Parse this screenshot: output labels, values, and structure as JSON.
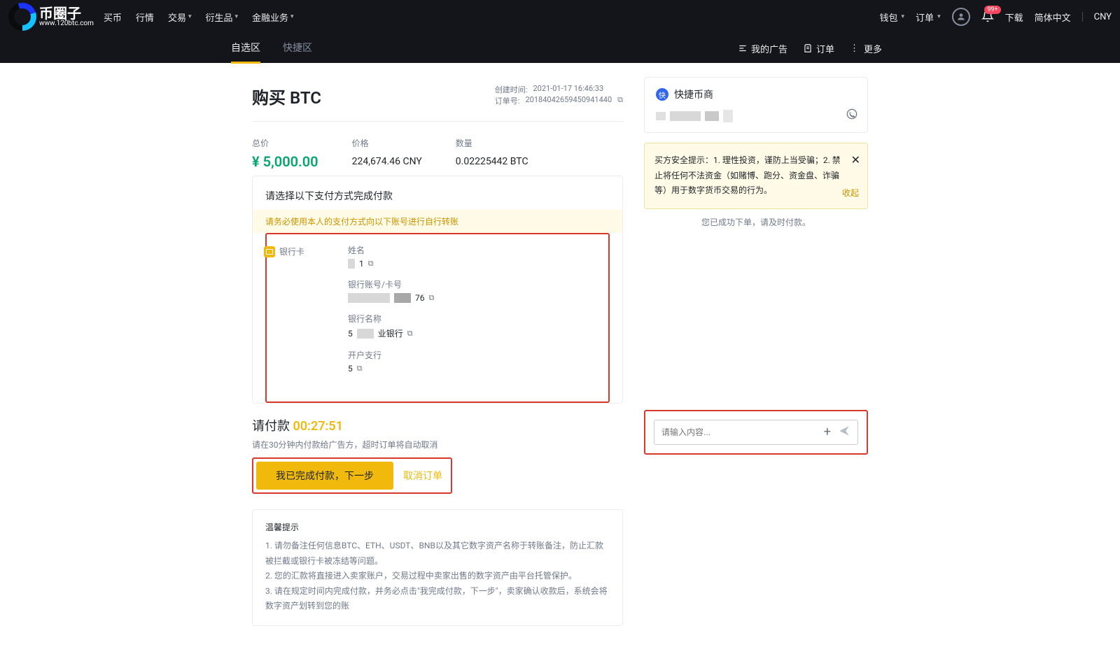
{
  "logo": {
    "cn": "币圈子",
    "url": "www.120btc.com"
  },
  "nav": {
    "buy": "买币",
    "market": "行情",
    "trade": "交易",
    "deriv": "衍生品",
    "finance": "金融业务"
  },
  "topright": {
    "wallet": "钱包",
    "orders": "订单",
    "badge": "99+",
    "download": "下载",
    "lang": "简体中文",
    "currency": "CNY"
  },
  "subnav": {
    "self": "自选区",
    "quick": "快捷区",
    "myads": "我的广告",
    "orders": "订单",
    "more": "更多"
  },
  "header": {
    "title": "购买 BTC",
    "created_label": "创建时间:",
    "created_value": "2021-01-17 16:46:33",
    "order_label": "订单号:",
    "order_value": "20184042659450941440"
  },
  "summary": {
    "total_label": "总价",
    "total_value": "¥ 5,000.00",
    "price_label": "价格",
    "price_value": "224,674.46 CNY",
    "qty_label": "数量",
    "qty_value": "0.02225442 BTC"
  },
  "payment": {
    "title": "请选择以下支付方式完成付款",
    "banner": "请务必使用本人的支付方式向以下账号进行自行转账",
    "method": "银行卡",
    "f_name": "姓名",
    "f_acct": "银行账号/卡号",
    "f_acct_suffix": "76",
    "f_bankname": "银行名称",
    "f_bankname_val_pref": "5",
    "f_bankname_val_suf": "业银行",
    "f_branch": "开户支行",
    "f_branch_val": "5"
  },
  "countdown": {
    "label": "请付款",
    "time": "00:27:51",
    "note": "请在30分钟内付款给广告方，超时订单将自动取消",
    "confirm": "我已完成付款，下一步",
    "cancel": "取消订单"
  },
  "tips": {
    "title": "温馨提示",
    "t1": "1. 请勿备注任何信息BTC、ETH、USDT、BNB以及其它数字资产名称于转账备注，防止汇款被拦截或银行卡被冻结等问题。",
    "t2": "2. 您的汇款将直接进入卖家账户，交易过程中卖家出售的数字资产由平台托管保护。",
    "t3": "3. 请在规定时间内完成付款，并务必点击\"我完成付款，下一步\"，卖家确认收款后，系统会将数字资产划转到您的账"
  },
  "side": {
    "merchant_title": "快捷币商",
    "alert": "买方安全提示：1. 理性投资，谨防上当受骗；2. 禁止将任何不法资金（如赌博、跑分、资金盘、诈骗等）用于数字货币交易的行为。",
    "collapse": "收起",
    "success": "您已成功下单，请及时付款。",
    "chat_placeholder": "请输入内容..."
  }
}
